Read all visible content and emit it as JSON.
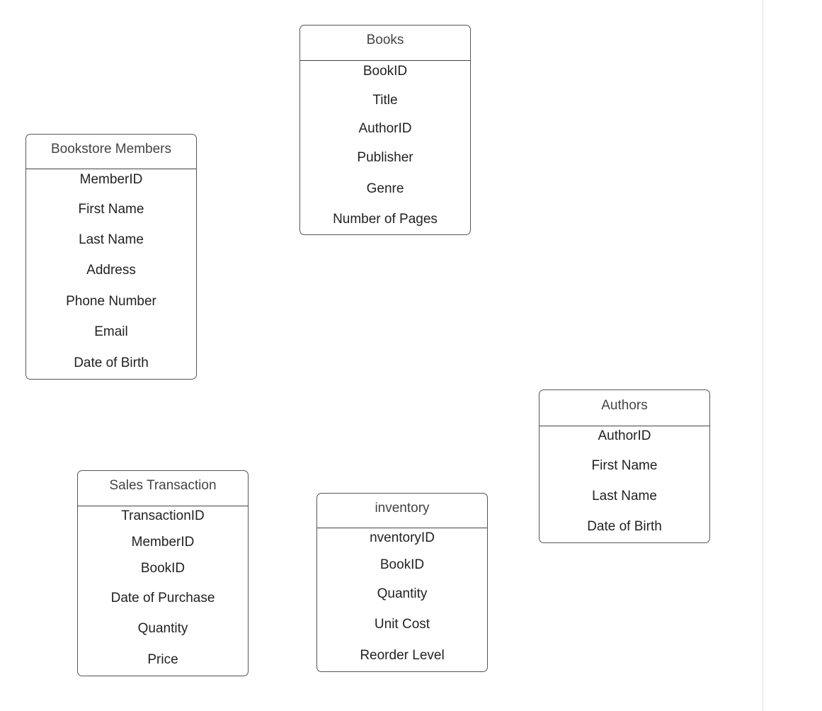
{
  "entities": [
    {
      "id": "books",
      "title": "Books",
      "fields": [
        "BookID",
        "Title",
        "AuthorID",
        "Publisher",
        "Genre",
        "Number of Pages"
      ]
    },
    {
      "id": "bookstore-members",
      "title": "Bookstore Members",
      "fields": [
        "MemberID",
        "First Name",
        "Last Name",
        "Address",
        "Phone Number",
        "Email",
        "Date of Birth"
      ]
    },
    {
      "id": "authors",
      "title": "Authors",
      "fields": [
        "AuthorID",
        "First Name",
        "Last Name",
        "Date of Birth"
      ]
    },
    {
      "id": "sales-transaction",
      "title": "Sales Transaction",
      "fields": [
        "TransactionID",
        "MemberID",
        "BookID",
        "Date of Purchase",
        "Quantity",
        "Price"
      ]
    },
    {
      "id": "inventory",
      "title": "inventory",
      "fields": [
        "nventoryID",
        "BookID",
        "Quantity",
        "Unit Cost",
        "Reorder Level"
      ]
    }
  ]
}
